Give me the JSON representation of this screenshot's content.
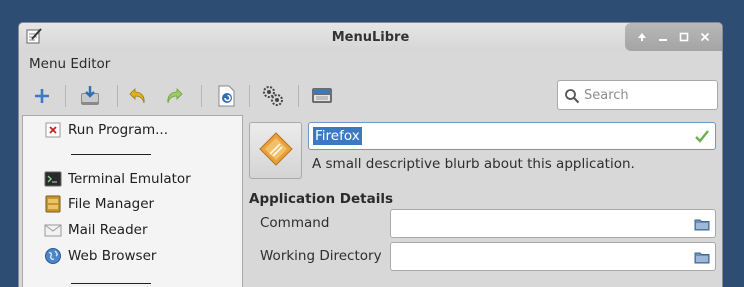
{
  "window": {
    "title": "MenuLibre",
    "controls": [
      "maximize-arrow-icon",
      "minimize-icon",
      "restore-icon",
      "close-icon"
    ]
  },
  "menubar": {
    "menu_editor": "Menu Editor"
  },
  "toolbar": {
    "buttons": [
      "add-icon",
      "save-icon",
      "undo-icon",
      "redo-icon",
      "revert-icon",
      "run-icon",
      "settings-icon"
    ],
    "search_placeholder": "Search"
  },
  "sidebar": {
    "items": [
      {
        "label": "Run Program...",
        "icon": "run-program-icon"
      },
      {
        "label": "Terminal Emulator",
        "icon": "terminal-icon"
      },
      {
        "label": "File Manager",
        "icon": "file-manager-icon"
      },
      {
        "label": "Mail Reader",
        "icon": "mail-icon"
      },
      {
        "label": "Web Browser",
        "icon": "web-browser-icon"
      }
    ]
  },
  "main": {
    "name": "Firefox",
    "blurb": "A small descriptive blurb about this application.",
    "section_title": "Application Details",
    "fields": [
      {
        "label": "Command",
        "value": ""
      },
      {
        "label": "Working Directory",
        "value": ""
      }
    ]
  }
}
